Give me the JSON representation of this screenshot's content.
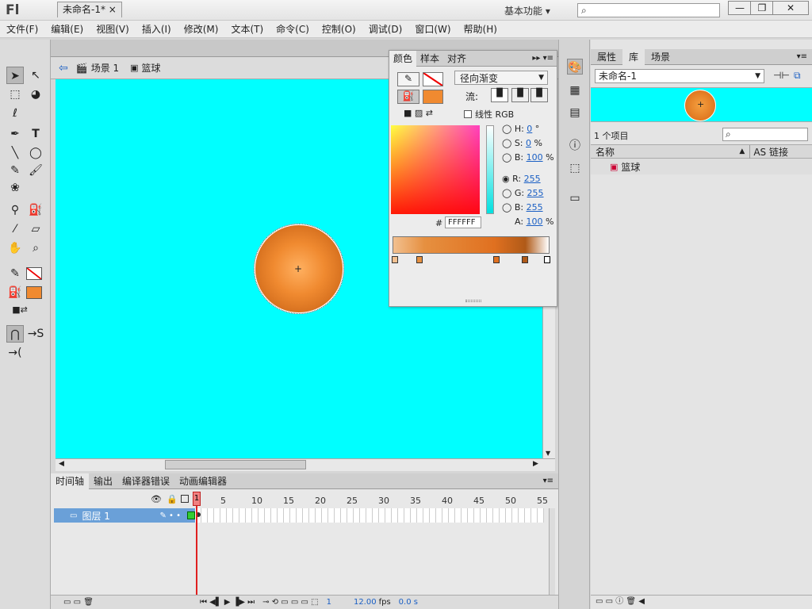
{
  "app": {
    "logo": "Fl",
    "workspace": "基本功能",
    "workspace_arrow": "▾",
    "search_placeholder": ""
  },
  "window": {
    "min": "—",
    "restore": "❐",
    "close": "✕"
  },
  "menu": [
    "文件(F)",
    "编辑(E)",
    "视图(V)",
    "插入(I)",
    "修改(M)",
    "文本(T)",
    "命令(C)",
    "控制(O)",
    "调试(D)",
    "窗口(W)",
    "帮助(H)"
  ],
  "doc": {
    "tab": "未命名-1*",
    "tab_close": "×",
    "scene": "场景 1",
    "symbol": "篮球"
  },
  "color_panel": {
    "tabs": [
      "颜色",
      "样本",
      "对齐"
    ],
    "fill_type": "径向渐变",
    "flow_label": "流:",
    "linear_rgb_label": "线性 RGB",
    "hsb": [
      {
        "label": "H:",
        "value": "0",
        "unit": "°"
      },
      {
        "label": "S:",
        "value": "0",
        "unit": "%"
      },
      {
        "label": "B:",
        "value": "100",
        "unit": "%"
      }
    ],
    "rgb": [
      {
        "label": "R:",
        "value": "255"
      },
      {
        "label": "G:",
        "value": "255"
      },
      {
        "label": "B:",
        "value": "255"
      }
    ],
    "hex_label": "#",
    "hex": "FFFFFF",
    "alpha_label": "A:",
    "alpha": "100",
    "alpha_unit": "%",
    "stops": [
      "#f2c090",
      "#e69040",
      "#e07020",
      "#b05a18",
      "#ffffff"
    ]
  },
  "right_panel": {
    "tabs": [
      "属性",
      "库",
      "场景"
    ],
    "library_select": "未命名-1",
    "item_count": "1 个项目",
    "col_name": "名称",
    "col_link": "AS 链接",
    "item_name": "篮球"
  },
  "timeline": {
    "tabs": [
      "时间轴",
      "输出",
      "编译器错误",
      "动画编辑器"
    ],
    "layer": "图层 1",
    "frame_numbers": [
      "1",
      "5",
      "10",
      "15",
      "20",
      "25",
      "30",
      "35",
      "40",
      "45",
      "50",
      "55"
    ],
    "current_frame": "1",
    "fps": "12.00",
    "fps_unit": "fps",
    "time": "0.0 s"
  },
  "colors": {
    "stage": "#00ffff",
    "ball": "#e07820",
    "accent": "#6aa0d8"
  }
}
